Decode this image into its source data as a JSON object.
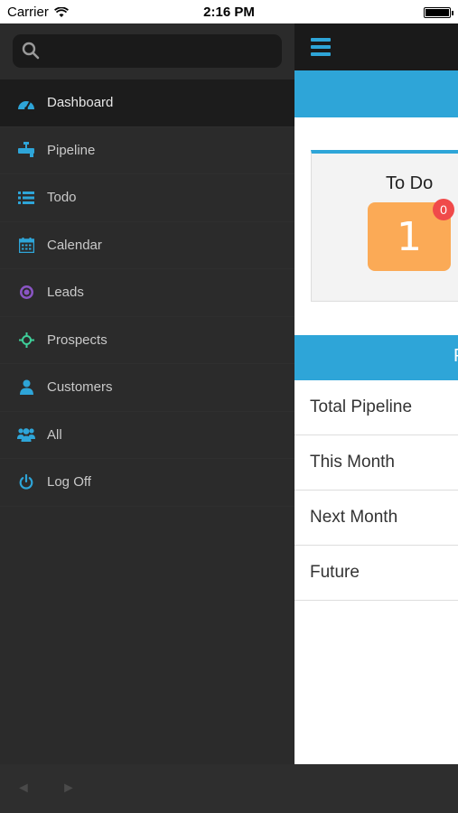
{
  "status_bar": {
    "carrier": "Carrier",
    "time": "2:16 PM",
    "battery_level": 1.0
  },
  "search": {
    "placeholder": "",
    "value": ""
  },
  "menu": {
    "items": [
      {
        "label": "Dashboard",
        "icon": "dashboard-icon"
      },
      {
        "label": "Pipeline",
        "icon": "pipeline-icon"
      },
      {
        "label": "Todo",
        "icon": "list-icon"
      },
      {
        "label": "Calendar",
        "icon": "calendar-icon"
      },
      {
        "label": "Leads",
        "icon": "target-icon"
      },
      {
        "label": "Prospects",
        "icon": "crosshair-icon"
      },
      {
        "label": "Customers",
        "icon": "user-icon"
      },
      {
        "label": "All",
        "icon": "users-icon"
      },
      {
        "label": "Log Off",
        "icon": "power-icon"
      }
    ],
    "active": "Dashboard"
  },
  "bottom_bar": {
    "back_arrow": "◄",
    "forward_arrow": "►"
  },
  "main": {
    "todo_card": {
      "title": "To Do",
      "count": "1",
      "badge": "0"
    },
    "pipeline_header": "P",
    "pipeline_rows": [
      "Total Pipeline",
      "This Month",
      "Next Month",
      "Future"
    ]
  },
  "colors": {
    "accent": "#2ea5d8",
    "sidebar_bg": "#2b2b2b",
    "tile": "#fbaa56",
    "badge": "#f04a4a"
  }
}
